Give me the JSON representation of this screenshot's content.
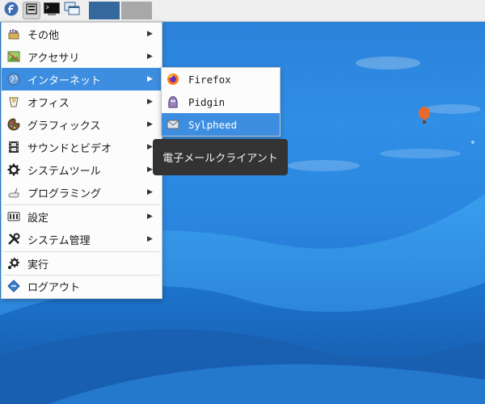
{
  "desktop": {
    "colors": {
      "panel_bg": "#efefef",
      "highlight": "#3d8ee0",
      "tooltip_bg": "#333333"
    }
  },
  "panel": {
    "buttons": [
      {
        "icon": "fedora-logo-icon"
      },
      {
        "icon": "show-desktop-icon"
      },
      {
        "icon": "terminal-icon"
      },
      {
        "icon": "window-list-icon"
      }
    ],
    "workspaces": [
      {
        "name": "workspace-1"
      },
      {
        "name": "workspace-2"
      }
    ]
  },
  "main_menu": {
    "items": [
      {
        "label": "その他",
        "icon": "other-icon",
        "submenu": true
      },
      {
        "label": "アクセサリ",
        "icon": "accessories-icon",
        "submenu": true
      },
      {
        "label": "インターネット",
        "icon": "internet-globe-icon",
        "submenu": true,
        "highlighted": true
      },
      {
        "label": "オフィス",
        "icon": "office-icon",
        "submenu": true
      },
      {
        "label": "グラフィックス",
        "icon": "graphics-palette-icon",
        "submenu": true
      },
      {
        "label": "サウンドとビデオ",
        "icon": "multimedia-film-icon",
        "submenu": true
      },
      {
        "label": "システムツール",
        "icon": "system-tools-gear-icon",
        "submenu": true
      },
      {
        "label": "プログラミング",
        "icon": "programming-icon",
        "submenu": true
      },
      {
        "label": "設定",
        "icon": "settings-icon",
        "submenu": true
      },
      {
        "label": "システム管理",
        "icon": "system-admin-tools-icon",
        "submenu": true
      },
      {
        "label": "実行",
        "icon": "run-gear-icon",
        "submenu": false
      },
      {
        "label": "ログアウト",
        "icon": "logout-icon",
        "submenu": false
      }
    ]
  },
  "internet_submenu": {
    "items": [
      {
        "label": "Firefox",
        "icon": "firefox-icon"
      },
      {
        "label": "Pidgin",
        "icon": "pidgin-icon"
      },
      {
        "label": "Sylpheed",
        "icon": "sylpheed-icon",
        "highlighted": true
      }
    ]
  },
  "tooltip": {
    "text": "電子メールクライアント"
  }
}
